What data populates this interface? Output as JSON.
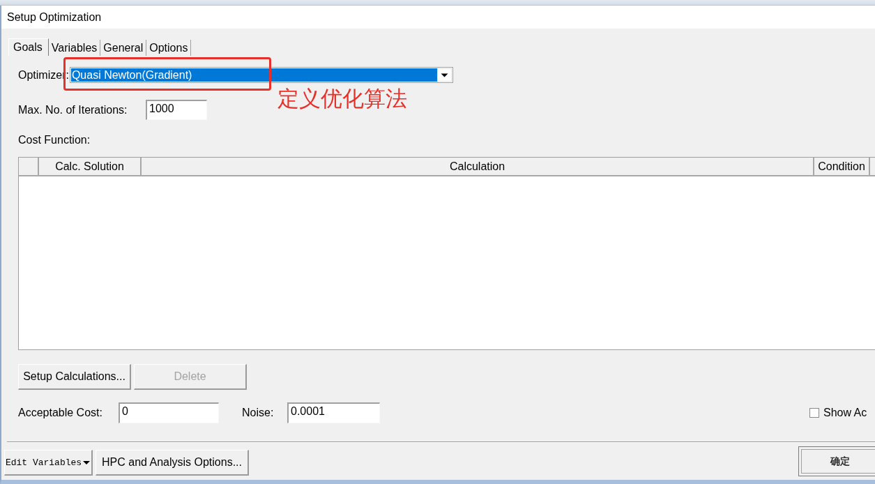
{
  "window": {
    "title": "Setup Optimization"
  },
  "tabs": [
    {
      "label": "Goals",
      "selected": true
    },
    {
      "label": "Variables",
      "selected": false
    },
    {
      "label": "General",
      "selected": false
    },
    {
      "label": "Options",
      "selected": false
    }
  ],
  "optimizer": {
    "label": "Optimizer:",
    "value": "Quasi Newton(Gradient)",
    "text_selected": true
  },
  "annotation": {
    "text": "定义优化算法"
  },
  "max_iterations": {
    "label": "Max. No. of Iterations:",
    "value": "1000"
  },
  "cost_function": {
    "label": "Cost Function:",
    "table": {
      "columns": [
        "Calc. Solution",
        "Calculation",
        "Condition"
      ]
    }
  },
  "buttons": [
    {
      "label": "Setup Calculations...",
      "disabled": false
    },
    {
      "label": "Delete",
      "disabled": true
    }
  ],
  "acceptable_cost": {
    "label": "Acceptable Cost:",
    "value": "0"
  },
  "noise": {
    "label": "Noise:",
    "value": "0.0001"
  },
  "show_option": {
    "label": "Show Ac",
    "checked": false
  },
  "footer_buttons": [
    {
      "label": "Edit Variables",
      "kind": "menu"
    },
    {
      "label": "HPC and Analysis Options...",
      "kind": "plain"
    }
  ],
  "ok_button": {
    "label": "确定"
  }
}
